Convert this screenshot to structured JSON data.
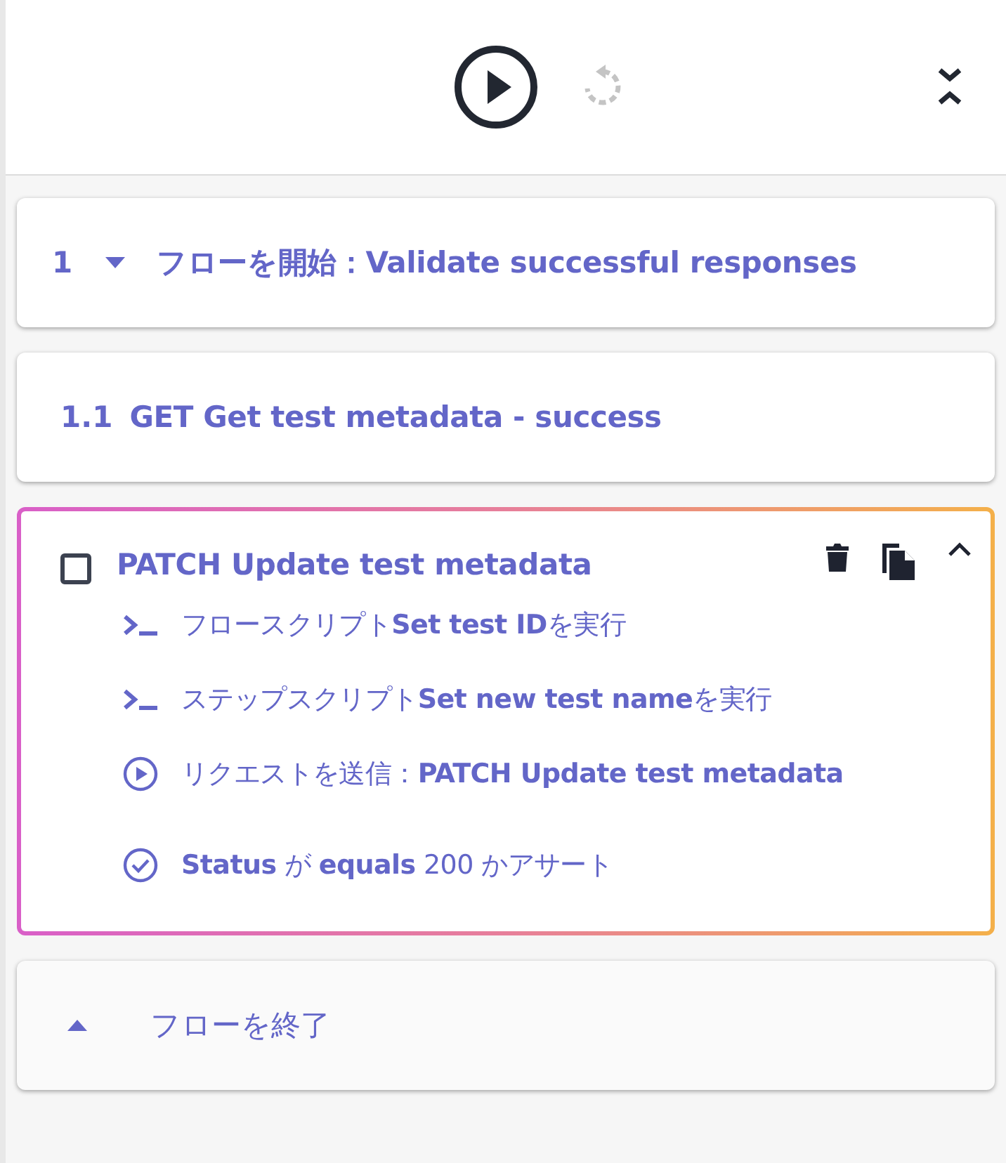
{
  "toolbar": {
    "buttons": [
      {
        "kind": "run",
        "disabled": false
      },
      {
        "kind": "reset",
        "disabled": true
      },
      {
        "kind": "collapse_all",
        "disabled": false
      }
    ]
  },
  "steps": [
    {
      "kind": "flow_start",
      "number": "1",
      "label": "フローを開始：Validate successful responses",
      "selected": false
    },
    {
      "kind": "request",
      "number": "1.1",
      "label": "GET Get test metadata - success",
      "selected": false
    },
    {
      "kind": "request",
      "label": "PATCH Update test metadata",
      "selected": true,
      "checked": false,
      "expanded": true,
      "actions": [
        {
          "kind": "script",
          "text": "フロースクリプト**Set test ID**を実行"
        },
        {
          "kind": "script",
          "text": "ステップスクリプト**Set new test name**を実行"
        },
        {
          "kind": "send",
          "text": "リクエストを送信：**PATCH Update test metadata**"
        },
        {
          "kind": "assert",
          "text": "**Status** が **equals** 200 かアサート"
        }
      ]
    },
    {
      "kind": "flow_end",
      "label": "フローを終了",
      "selected": false
    }
  ]
}
